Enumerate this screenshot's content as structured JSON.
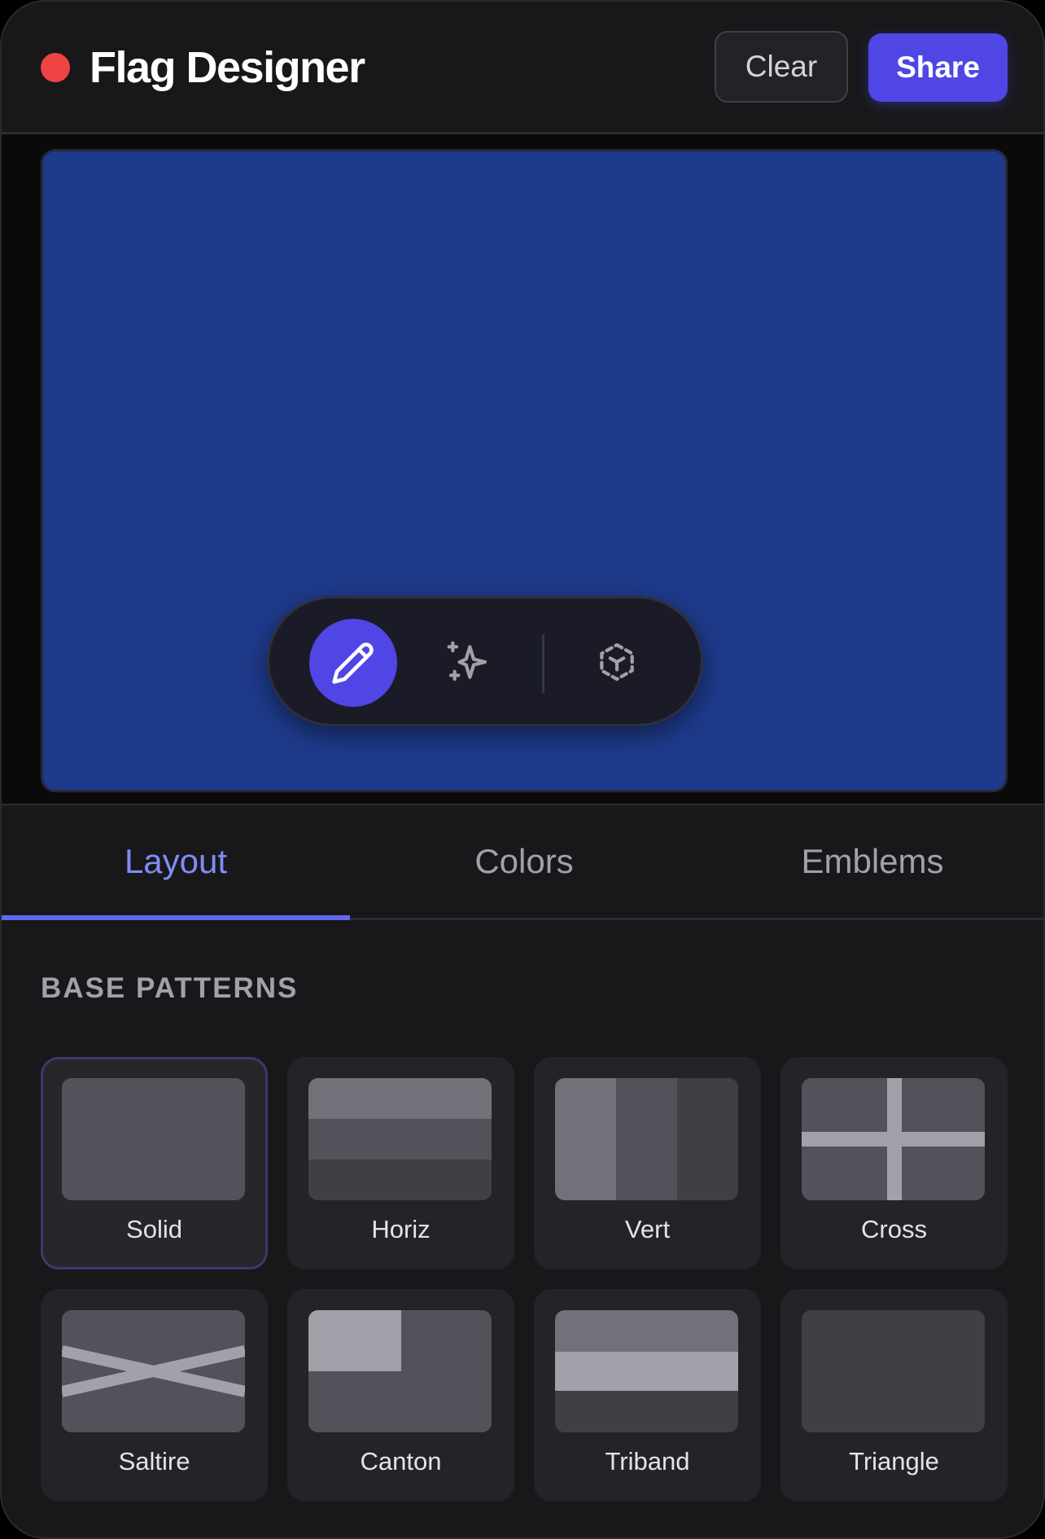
{
  "header": {
    "title": "Flag Designer",
    "clear_label": "Clear",
    "share_label": "Share",
    "status_color": "#ef4444",
    "accent_color": "#4f46e5"
  },
  "canvas": {
    "flag_color": "#1e3a8a",
    "toolbar": {
      "tools": [
        {
          "name": "pencil-icon",
          "active": true
        },
        {
          "name": "sparkle-icon",
          "active": false
        },
        {
          "name": "select-icon",
          "active": false
        }
      ]
    }
  },
  "tabs": [
    {
      "label": "Layout",
      "active": true
    },
    {
      "label": "Colors",
      "active": false
    },
    {
      "label": "Emblems",
      "active": false
    }
  ],
  "patterns": {
    "title": "BASE PATTERNS",
    "items": [
      {
        "label": "Solid",
        "selected": true
      },
      {
        "label": "Horiz",
        "selected": false
      },
      {
        "label": "Vert",
        "selected": false
      },
      {
        "label": "Cross",
        "selected": false
      },
      {
        "label": "Saltire",
        "selected": false
      },
      {
        "label": "Canton",
        "selected": false
      },
      {
        "label": "Triband",
        "selected": false
      },
      {
        "label": "Triangle",
        "selected": false
      }
    ]
  }
}
